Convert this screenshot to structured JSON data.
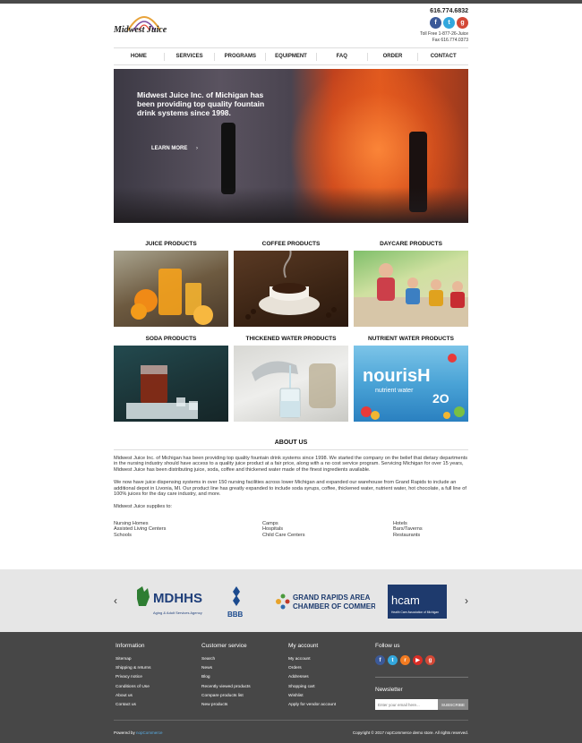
{
  "header": {
    "logo_text": "Midwest Juice",
    "phone": "616.774.6832",
    "tollfree": "Toll Free 1-877-26-Juice",
    "fax": "Fax 616.774.0373",
    "social": [
      "facebook-icon",
      "twitter-icon",
      "google-plus-icon"
    ]
  },
  "nav": {
    "items": [
      "HOME",
      "SERVICES",
      "PROGRAMS",
      "EQUIPMENT",
      "FAQ",
      "ORDER",
      "CONTACT"
    ]
  },
  "hero": {
    "text": "Midwest Juice Inc. of Michigan has been providing top quality fountain drink systems since 1998.",
    "link": "LEARN MORE"
  },
  "products": [
    {
      "title": "JUICE PRODUCTS"
    },
    {
      "title": "COFFEE PRODUCTS"
    },
    {
      "title": "DAYCARE PRODUCTS"
    },
    {
      "title": "SODA PRODUCTS"
    },
    {
      "title": "THICKENED WATER PRODUCTS"
    },
    {
      "title": "NUTRIENT WATER PRODUCTS"
    }
  ],
  "product_images": {
    "nourish_text": "nourisH",
    "nourish_sub": "nutrient water",
    "nourish_h2o": "2O"
  },
  "about": {
    "title": "ABOUT US",
    "p1": "Midwest Juice Inc. of Michigan has been providing top quality fountain drink systems since 1998.  We started the company on the belief that dietary departments in the nursing industry should have access to a quality juice product at a fair price, along with a no cost service program. Servicing Michigan for over 15 years, Midwest Juice has been distributing juice, soda, coffee and thickened water made of the finest ingredients available.",
    "p2": "We now have juice dispensing systems in over 150 nursing facilities across lower Michigan and expanded our warehouse from Grand Rapids to include an additional depot in Livonia, MI.  Our product line has greatly expanded to include soda syrups, coffee, thickened water, nutrient water, hot chocolate, a full line of 100% juices for the day care industry,  and more.",
    "p3": "Midwest Juice supplies to:",
    "col1": [
      "Nursing Homes",
      "Assisted Living Centers",
      "Schools"
    ],
    "col2": [
      "Camps",
      "Hospitals",
      "Child Care Centers"
    ],
    "col3": [
      "Hotels",
      "Bars/Taverns",
      "Restaurants"
    ]
  },
  "partners": {
    "mdhhs": "MDHHS",
    "mdhhs_sub": "Aging & Adult Services Agency",
    "bbb": "BBB",
    "grand_rapids_1": "GRAND RAPIDS AREA",
    "grand_rapids_2": "CHAMBER OF COMMERCE",
    "hcam": "hcam",
    "hcam_sub": "Health Care Association of Michigan"
  },
  "footer": {
    "information_title": "Information",
    "information": [
      "Sitemap",
      "Shipping & returns",
      "Privacy notice",
      "Conditions of Use",
      "About us",
      "Contact us"
    ],
    "customer_title": "Customer service",
    "customer": [
      "Search",
      "News",
      "Blog",
      "Recently viewed products",
      "Compare products list",
      "New products"
    ],
    "account_title": "My account",
    "account": [
      "My account",
      "Orders",
      "Addresses",
      "Shopping cart",
      "Wishlist",
      "Apply for vendor account"
    ],
    "follow_title": "Follow us",
    "follow_icons": [
      "facebook-icon",
      "twitter-icon",
      "rss-icon",
      "youtube-icon",
      "google-plus-icon"
    ],
    "newsletter_title": "Newsletter",
    "newsletter_placeholder": "Enter your email here...",
    "subscribe": "SUBSCRIBE",
    "powered_prefix": "Powered by",
    "powered_brand": "nopCommerce",
    "copyright": "Copyright © 2017 nopCommerce demo store. All rights reserved."
  }
}
